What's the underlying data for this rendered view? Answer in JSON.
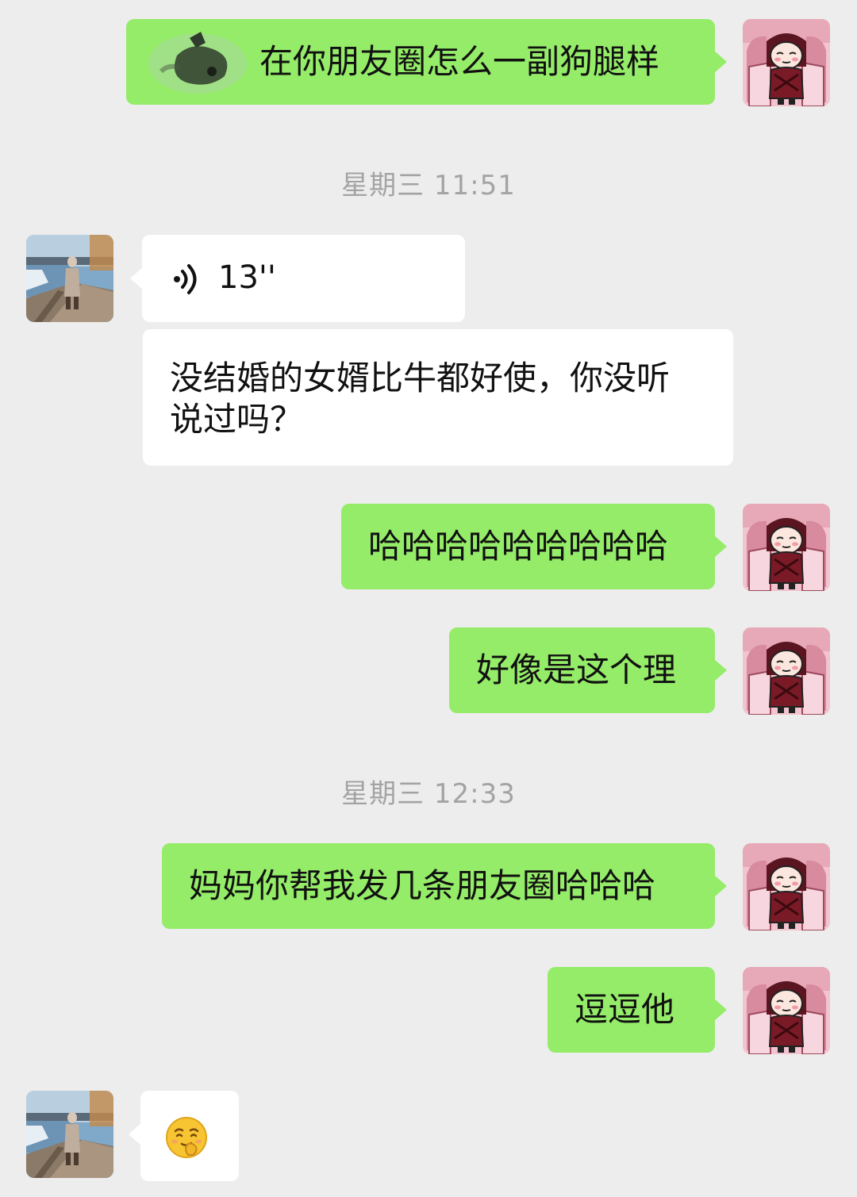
{
  "messages": [
    {
      "id": "m1",
      "sender": "self",
      "type": "text",
      "text": "在你朋友圈怎么一副狗腿样",
      "has_redacted_prefix": true
    },
    {
      "id": "t1",
      "type": "timestamp",
      "text": "星期三 11:51"
    },
    {
      "id": "m2",
      "sender": "peer",
      "type": "voice",
      "duration": "13''"
    },
    {
      "id": "m3",
      "sender": "peer",
      "type": "text",
      "lines": [
        "没结婚的女婿比牛都好使，你没听",
        "说过吗？"
      ]
    },
    {
      "id": "m4",
      "sender": "self",
      "type": "text",
      "text": "哈哈哈哈哈哈哈哈哈"
    },
    {
      "id": "m5",
      "sender": "self",
      "type": "text",
      "text": "好像是这个理"
    },
    {
      "id": "t2",
      "type": "timestamp",
      "text": "星期三 12:33"
    },
    {
      "id": "m6",
      "sender": "self",
      "type": "text",
      "text": "妈妈你帮我发几条朋友圈哈哈哈"
    },
    {
      "id": "m7",
      "sender": "self",
      "type": "text",
      "text": "逗逗他"
    },
    {
      "id": "m8",
      "sender": "peer",
      "type": "emoji",
      "emoji": "smirk-emoji"
    }
  ],
  "avatars": {
    "self": {
      "icon": "cartoon-girl-avatar-icon"
    },
    "peer": {
      "icon": "lakeside-photo-avatar-icon"
    }
  },
  "colors": {
    "background": "#ededed",
    "self_bubble": "#95ec69",
    "peer_bubble": "#ffffff",
    "timestamp_text": "#a3a3a3",
    "message_text": "#111111"
  }
}
